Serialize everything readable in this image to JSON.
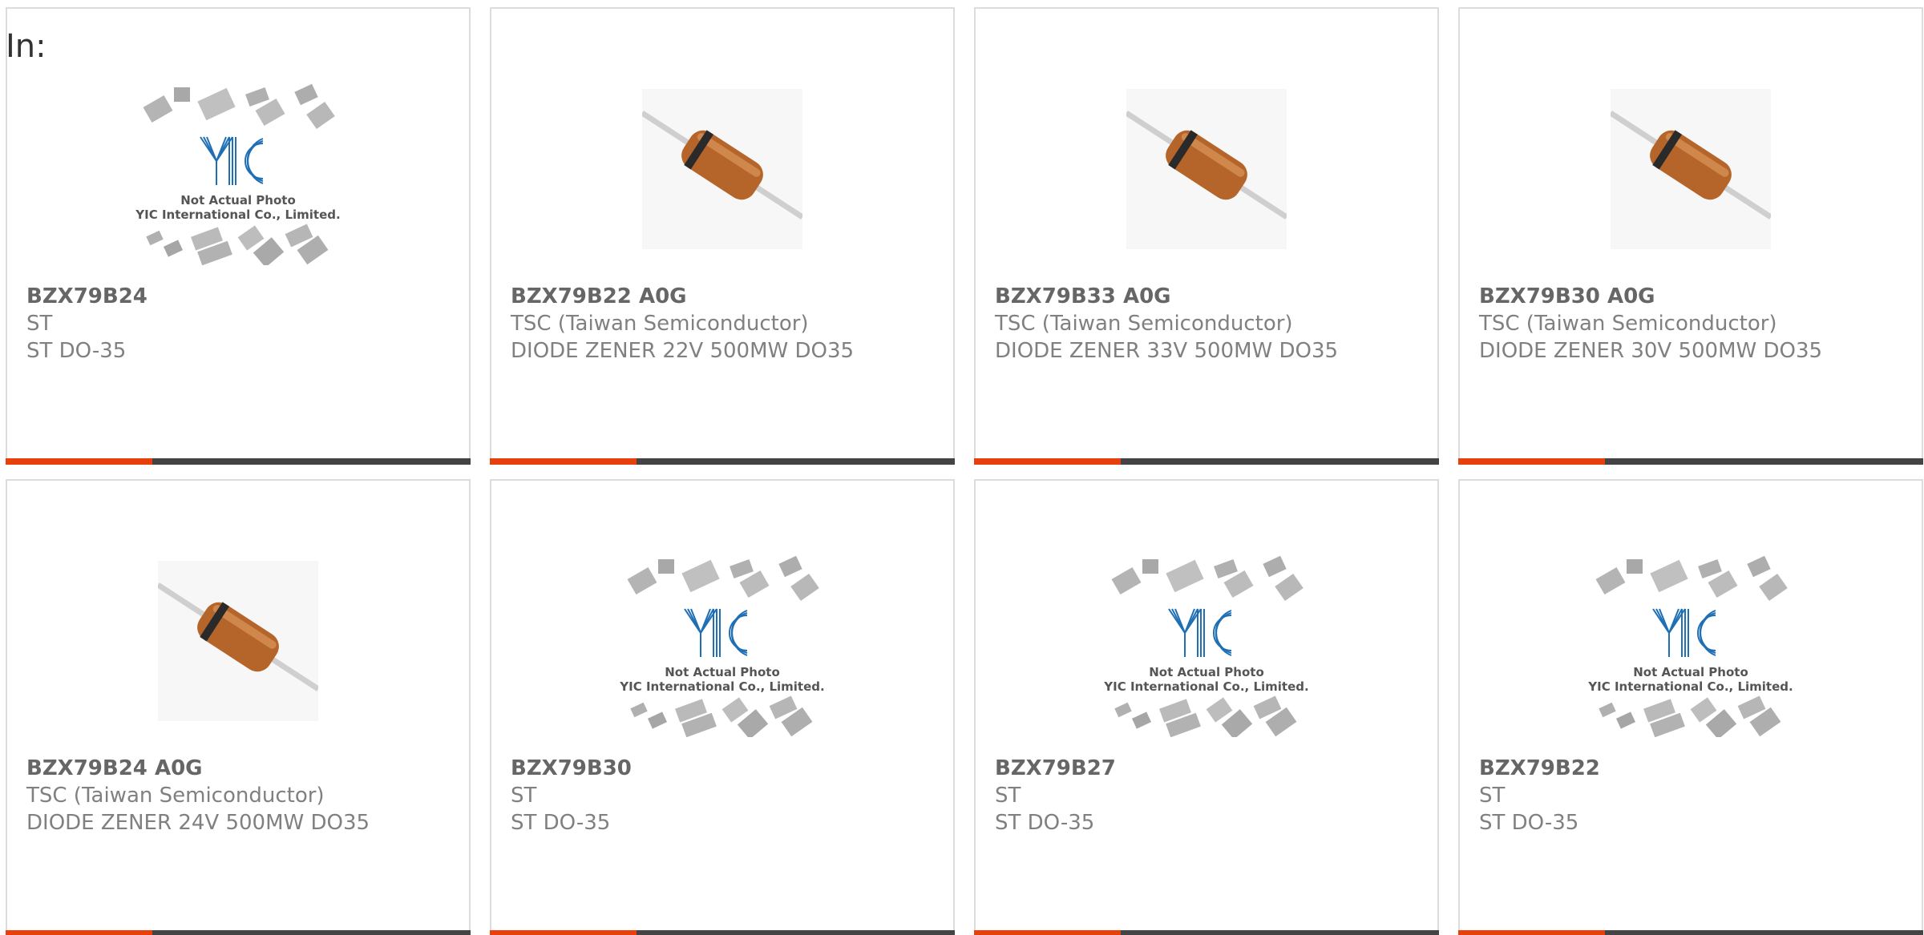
{
  "header": {
    "in_label": "In:"
  },
  "placeholder": {
    "logo_text": "YIC",
    "line1": "Not Actual Photo",
    "line2": "YIC International Co., Limited."
  },
  "colors": {
    "accent": "#e8400c",
    "bar": "#444444",
    "border": "#dcdcdc",
    "logo_blue": "#1f6fb5",
    "diode_body": "#b5652a",
    "diode_band": "#2a2a2a"
  },
  "products": [
    {
      "part_number": "BZX79B24",
      "manufacturer": "ST",
      "description": "ST DO-35",
      "image": "placeholder"
    },
    {
      "part_number": "BZX79B22 A0G",
      "manufacturer": "TSC (Taiwan Semiconductor)",
      "description": "DIODE ZENER 22V 500MW DO35",
      "image": "diode-photo"
    },
    {
      "part_number": "BZX79B33 A0G",
      "manufacturer": "TSC (Taiwan Semiconductor)",
      "description": "DIODE ZENER 33V 500MW DO35",
      "image": "diode-photo"
    },
    {
      "part_number": "BZX79B30 A0G",
      "manufacturer": "TSC (Taiwan Semiconductor)",
      "description": "DIODE ZENER 30V 500MW DO35",
      "image": "diode-photo"
    },
    {
      "part_number": "BZX79B24 A0G",
      "manufacturer": "TSC (Taiwan Semiconductor)",
      "description": "DIODE ZENER 24V 500MW DO35",
      "image": "diode-photo"
    },
    {
      "part_number": "BZX79B30",
      "manufacturer": "ST",
      "description": "ST DO-35",
      "image": "placeholder"
    },
    {
      "part_number": "BZX79B27",
      "manufacturer": "ST",
      "description": "ST DO-35",
      "image": "placeholder"
    },
    {
      "part_number": "BZX79B22",
      "manufacturer": "ST",
      "description": "ST DO-35",
      "image": "placeholder"
    }
  ]
}
